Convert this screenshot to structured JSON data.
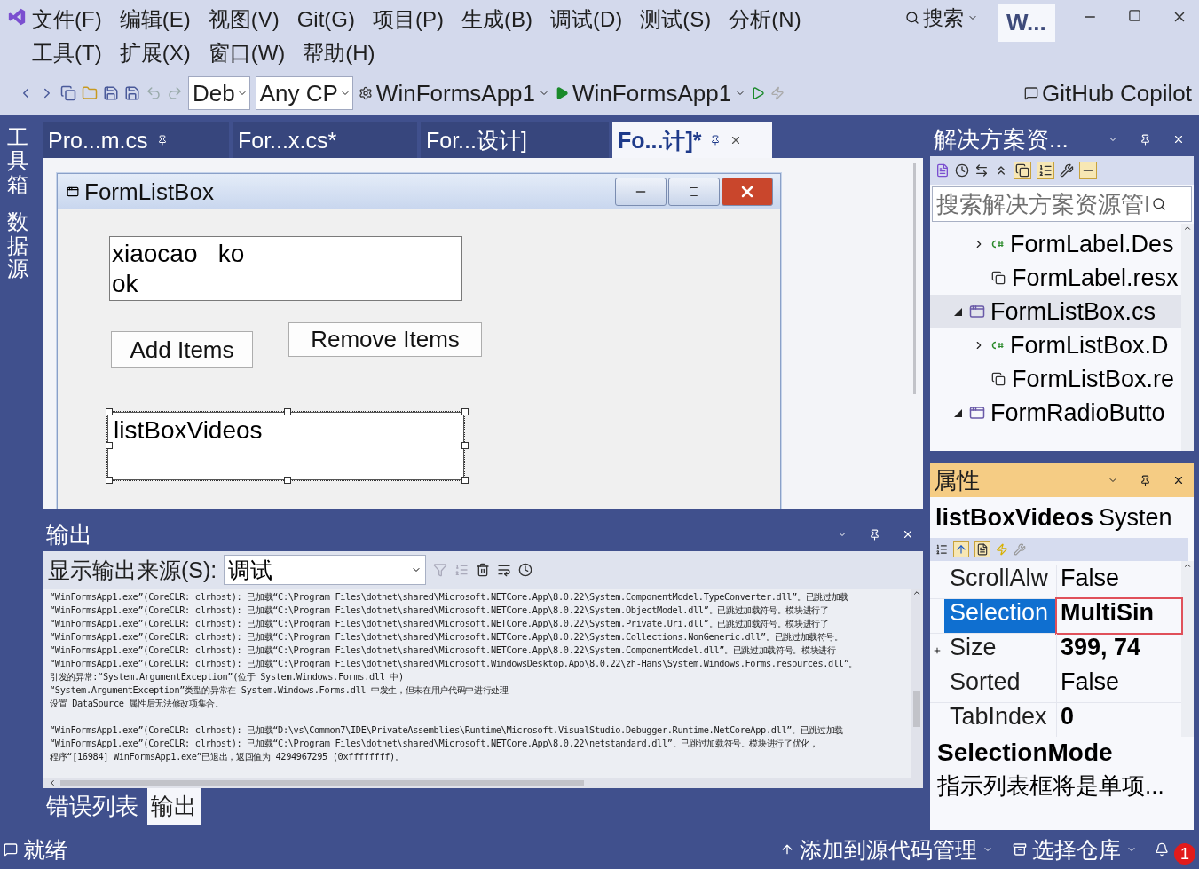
{
  "menu": [
    {
      "label": "文件(F)"
    },
    {
      "label": "编辑(E)"
    },
    {
      "label": "视图(V)"
    },
    {
      "label": "Git(G)"
    },
    {
      "label": "项目(P)"
    },
    {
      "label": "生成(B)"
    },
    {
      "label": "调试(D)"
    },
    {
      "label": "测试(S)"
    },
    {
      "label": "分析(N)"
    },
    {
      "label": "工具(T)"
    },
    {
      "label": "扩展(X)"
    },
    {
      "label": "窗口(W)"
    },
    {
      "label": "帮助(H)"
    }
  ],
  "search": {
    "label": "搜索"
  },
  "solution_badge": "W...",
  "toolbar": {
    "configuration": "Deb",
    "platform": "Any CP",
    "startup_project": "WinFormsApp1",
    "run_target": "WinFormsApp1",
    "copilot": "GitHub Copilot"
  },
  "side_tabs": [
    {
      "label": "工具箱"
    },
    {
      "label": "数据源"
    }
  ],
  "doc_tabs": [
    {
      "label": "Pro...m.cs",
      "selected": false
    },
    {
      "label": "For...x.cs*",
      "selected": false
    },
    {
      "label": "For...设计]",
      "selected": false
    },
    {
      "label": "Fo...计]*",
      "selected": true
    }
  ],
  "designer": {
    "form_title": "FormListBox",
    "textbox_lines": [
      "xiaocao   ko",
      "ok"
    ],
    "buttons": [
      {
        "label": "Add Items"
      },
      {
        "label": "Remove Items"
      }
    ],
    "listbox": {
      "label": "listBoxVideos",
      "selected": true
    }
  },
  "output": {
    "title": "输出",
    "source_label": "显示输出来源(S):",
    "source": "调试",
    "lines": [
      "“WinFormsApp1.exe”(CoreCLR: clrhost): 已加载“C:\\Program Files\\dotnet\\shared\\Microsoft.NETCore.App\\8.0.22\\System.ComponentModel.TypeConverter.dll”。已跳过加载",
      "“WinFormsApp1.exe”(CoreCLR: clrhost): 已加载“C:\\Program Files\\dotnet\\shared\\Microsoft.NETCore.App\\8.0.22\\System.ObjectModel.dll”。已跳过加载符号。模块进行了",
      "“WinFormsApp1.exe”(CoreCLR: clrhost): 已加载“C:\\Program Files\\dotnet\\shared\\Microsoft.NETCore.App\\8.0.22\\System.Private.Uri.dll”。已跳过加载符号。模块进行了",
      "“WinFormsApp1.exe”(CoreCLR: clrhost): 已加载“C:\\Program Files\\dotnet\\shared\\Microsoft.NETCore.App\\8.0.22\\System.Collections.NonGeneric.dll”。已跳过加载符号。",
      "“WinFormsApp1.exe”(CoreCLR: clrhost): 已加载“C:\\Program Files\\dotnet\\shared\\Microsoft.NETCore.App\\8.0.22\\System.ComponentModel.dll”。已跳过加载符号。模块进行",
      "“WinFormsApp1.exe”(CoreCLR: clrhost): 已加载“C:\\Program Files\\dotnet\\shared\\Microsoft.WindowsDesktop.App\\8.0.22\\zh-Hans\\System.Windows.Forms.resources.dll”。",
      "引发的异常:“System.ArgumentException”(位于 System.Windows.Forms.dll 中)",
      "“System.ArgumentException”类型的异常在 System.Windows.Forms.dll 中发生，但未在用户代码中进行处理",
      "设置 DataSource 属性后无法修改项集合。",
      {
        "text": "“WinFormsApp1.exe”(CoreCLR: clrhost): 已加载“D:\\vs\\Common7\\IDE\\PrivateAssemblies\\Runtime\\Microsoft.VisualStudio.Debugger.Runtime.NetCoreApp.dll”。已跳过加载",
        "blank_line_before": true
      },
      "“WinFormsApp1.exe”(CoreCLR: clrhost): 已加载“C:\\Program Files\\dotnet\\shared\\Microsoft.NETCore.App\\8.0.22\\netstandard.dll”。已跳过加载符号。模块进行了优化，",
      "程序“[16984] WinFormsApp1.exe”已退出，返回值为 4294967295 (0xffffffff)。"
    ]
  },
  "bottom_tabs": [
    {
      "label": "错误列表",
      "selected": false
    },
    {
      "label": "输出",
      "selected": true
    }
  ],
  "solution_explorer": {
    "title": "解决方案资...",
    "search_placeholder": "搜索解决方案资源管I",
    "items": [
      {
        "children": [
          {
            "label": "FormLabel.Des",
            "kind": "csharp",
            "expanded": false,
            "selected": false
          },
          {
            "label": "FormLabel.resx",
            "kind": "resource",
            "selected": false
          }
        ]
      },
      {
        "label": "FormListBox.cs",
        "kind": "form",
        "expanded": true,
        "selected": true,
        "children": [
          {
            "label": "FormListBox.D",
            "kind": "csharp",
            "expanded": false,
            "selected": false
          },
          {
            "label": "FormListBox.re",
            "kind": "resource",
            "selected": false
          }
        ]
      },
      {
        "label": "FormRadioButto",
        "kind": "form",
        "expanded": true,
        "selected": false
      }
    ]
  },
  "properties": {
    "title": "属性",
    "object": "listBoxVideos",
    "object_type": "Systen",
    "rows": [
      {
        "name": "ScrollAlw",
        "value": "False",
        "bold": false,
        "selected": false
      },
      {
        "name": "Selection",
        "value": "MultiSin",
        "bold": true,
        "selected": true
      },
      {
        "name": "Size",
        "value": "399, 74",
        "bold": true,
        "selected": false,
        "expanded": false
      },
      {
        "name": "Sorted",
        "value": "False",
        "bold": false,
        "selected": false
      },
      {
        "name": "TabIndex",
        "value": "0",
        "bold": true,
        "selected": false
      }
    ],
    "description_title": "SelectionMode",
    "description": "指示列表框将是单项..."
  },
  "status": {
    "text": "就绪",
    "source_control": "添加到源代码管理",
    "repository": "选择仓库",
    "notifications": "1"
  }
}
